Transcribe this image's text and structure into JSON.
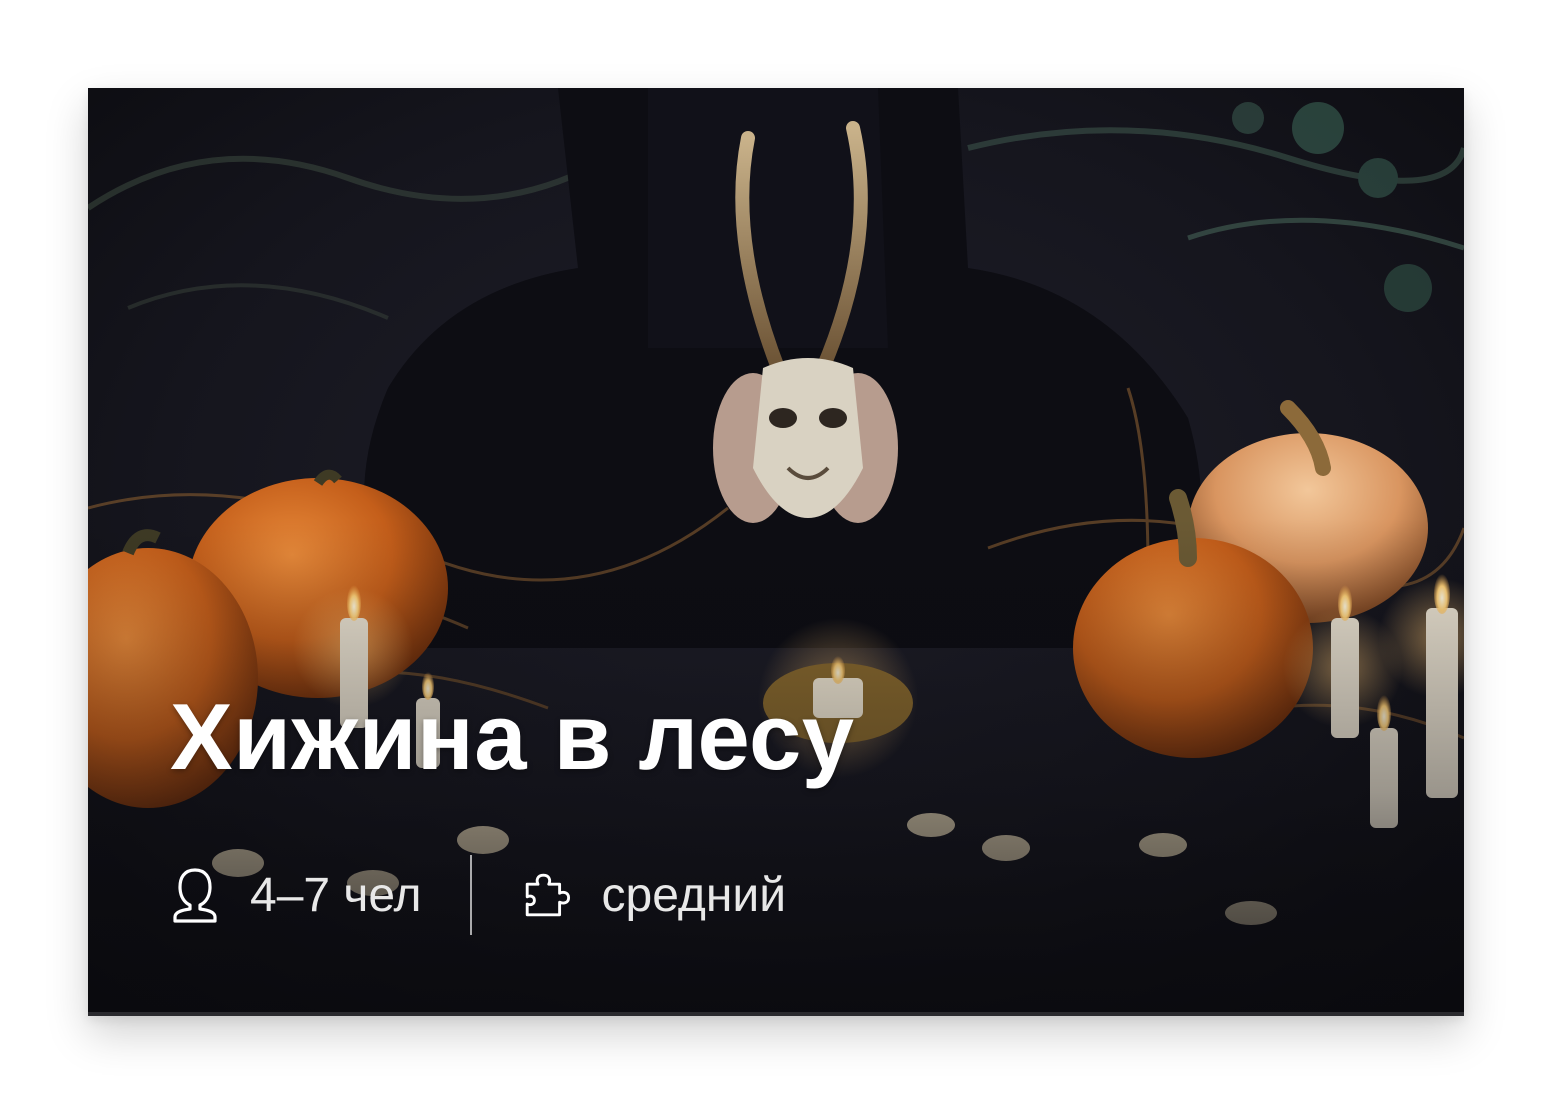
{
  "card": {
    "title": "Хижина в лесу",
    "players": {
      "icon": "person-icon",
      "label": "4–7 чел"
    },
    "difficulty": {
      "icon": "puzzle-icon",
      "label": "средний"
    }
  },
  "colors": {
    "text_primary": "#ffffff",
    "text_secondary": "#e8e8e8",
    "pumpkin": "#c8621e",
    "background": "#0f0f14"
  }
}
